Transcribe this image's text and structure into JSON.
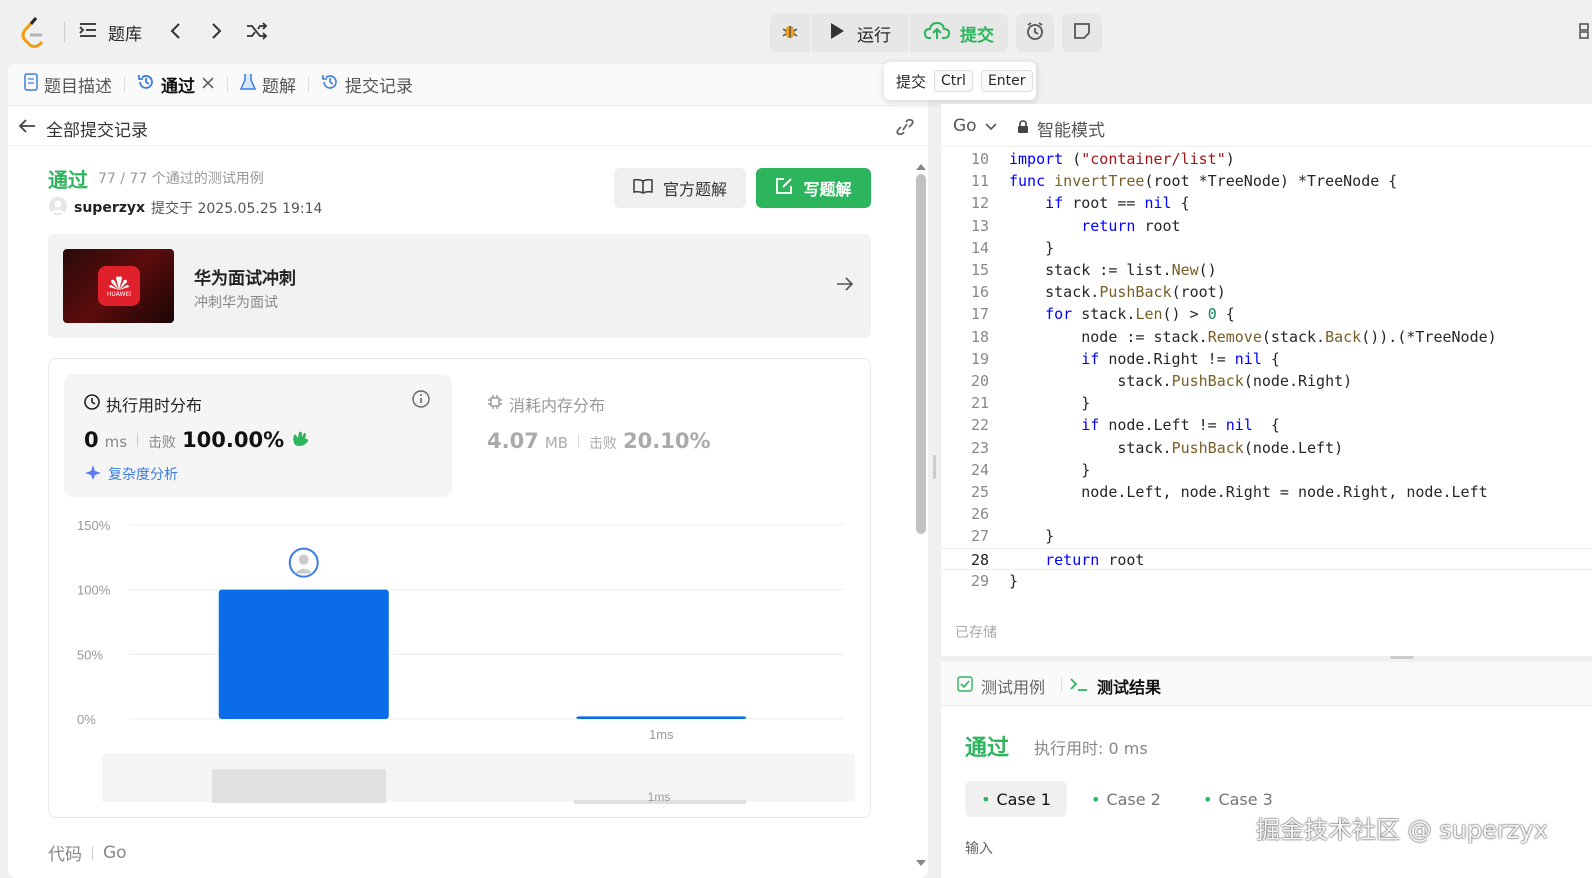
{
  "topbar": {
    "problem_bank": "题库",
    "run_label": "运行",
    "submit_label": "提交"
  },
  "tooltip": {
    "label": "提交",
    "key1": "Ctrl",
    "key2": "Enter"
  },
  "tabs": [
    {
      "label": "题目描述"
    },
    {
      "label": "通过"
    },
    {
      "label": "题解"
    },
    {
      "label": "提交记录"
    }
  ],
  "back": {
    "label": "全部提交记录"
  },
  "result": {
    "status": "通过",
    "cases": "77 / 77 个通过的测试用例",
    "user": "superzyx",
    "submitted_at": "提交于 2025.05.25 19:14",
    "official_solution": "官方题解",
    "write_solution": "写题解"
  },
  "promo": {
    "title": "华为面试冲刺",
    "subtitle": "冲刺华为面试",
    "logo_text": "HUAWEI"
  },
  "runtime": {
    "title": "执行用时分布",
    "value": "0",
    "unit": "ms",
    "beats_label": "击败",
    "beats": "100.00%",
    "analysis": "复杂度分析"
  },
  "memory": {
    "title": "消耗内存分布",
    "value": "4.07",
    "unit": "MB",
    "beats_label": "击败",
    "beats": "20.10%"
  },
  "chart_data": {
    "type": "bar",
    "y_tick_labels": [
      "150%",
      "100%",
      "50%",
      "0%"
    ],
    "ylim": [
      0,
      150
    ],
    "categories": [
      "",
      "1ms"
    ],
    "values": [
      100,
      2
    ],
    "minimap_label": "1ms"
  },
  "code_footer": {
    "label": "代码",
    "lang": "Go"
  },
  "editor": {
    "lang": "Go",
    "mode": "智能模式",
    "saved": "已存储",
    "lines": [
      {
        "n": "10",
        "t": "import (\"container/list\")"
      },
      {
        "n": "11",
        "t": "func invertTree(root *TreeNode) *TreeNode {"
      },
      {
        "n": "12",
        "t": "    if root == nil {"
      },
      {
        "n": "13",
        "t": "        return root"
      },
      {
        "n": "14",
        "t": "    }"
      },
      {
        "n": "15",
        "t": "    stack := list.New()"
      },
      {
        "n": "16",
        "t": "    stack.PushBack(root)"
      },
      {
        "n": "17",
        "t": "    for stack.Len() > 0 {"
      },
      {
        "n": "18",
        "t": "        node := stack.Remove(stack.Back()).(*TreeNode)"
      },
      {
        "n": "19",
        "t": "        if node.Right != nil {"
      },
      {
        "n": "20",
        "t": "            stack.PushBack(node.Right)"
      },
      {
        "n": "21",
        "t": "        }"
      },
      {
        "n": "22",
        "t": "        if node.Left != nil  {"
      },
      {
        "n": "23",
        "t": "            stack.PushBack(node.Left)"
      },
      {
        "n": "24",
        "t": "        }"
      },
      {
        "n": "25",
        "t": "        node.Left, node.Right = node.Right, node.Left"
      },
      {
        "n": "26",
        "t": ""
      },
      {
        "n": "27",
        "t": "    }"
      },
      {
        "n": "28",
        "t": "    return root"
      },
      {
        "n": "29",
        "t": "}"
      }
    ]
  },
  "test": {
    "tab_cases": "测试用例",
    "tab_result": "测试结果",
    "status": "通过",
    "runtime": "执行用时: 0 ms",
    "cases": [
      "Case 1",
      "Case 2",
      "Case 3"
    ],
    "input_label": "输入"
  },
  "watermark": "掘金技术社区 @ superzyx",
  "colors": {
    "accent_green": "#2db55d",
    "bar_blue": "#0a6ce8",
    "link_blue": "#3b7de0"
  }
}
